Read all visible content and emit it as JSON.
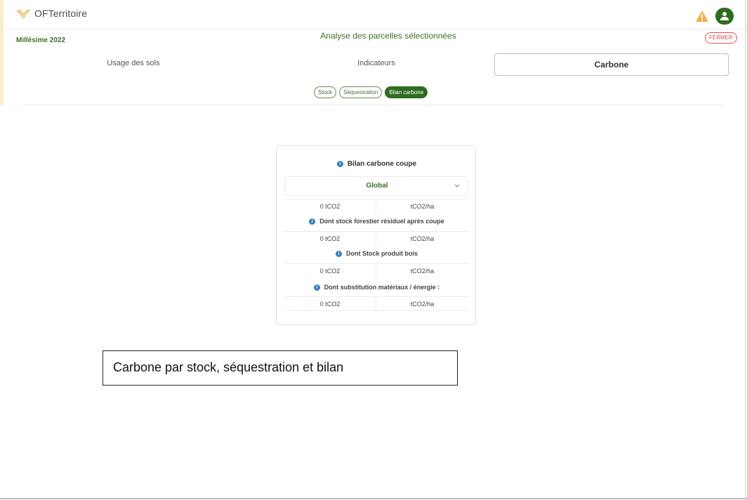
{
  "app": {
    "name": "OFTerritoire",
    "colors": {
      "brand_green": "#2e6b1f",
      "text_green": "#3f6f2a",
      "warning": "#f0ad4e",
      "danger": "#d9534f",
      "info": "#3a7fc1"
    }
  },
  "header": {
    "logo_icon": "bird-logo-icon",
    "warning_icon": "warning-triangle-icon",
    "user_icon": "user-icon"
  },
  "subheader": {
    "millesime": "Millésime 2022",
    "title": "Analyse des parcelles sélectionnées",
    "close_label": "FERMER"
  },
  "tabs": [
    {
      "label": "Usage des sols",
      "active": false
    },
    {
      "label": "Indicateurs",
      "active": false
    },
    {
      "label": "Carbone",
      "active": true
    }
  ],
  "pills": [
    {
      "label": "Stock",
      "active": false
    },
    {
      "label": "Séquestration",
      "active": false
    },
    {
      "label": "Bilan carbone",
      "active": true
    }
  ],
  "card": {
    "title": "Bilan carbone coupe",
    "select": {
      "selected": "Global"
    },
    "rows": [
      {
        "left": "0 tCO2",
        "right": "tCO2/ha"
      },
      {
        "left": "0 tCO2",
        "right": "tCO2/ha"
      },
      {
        "left": "0 tCO2",
        "right": "tCO2/ha"
      },
      {
        "left": "0 tCO2",
        "right": "tCO2/ha"
      }
    ],
    "subtitles": [
      "Dont stock forestier résiduel après coupe",
      "Dont Stock produit bois",
      "Dont substitution matériaux / énergie :"
    ]
  },
  "caption": "Carbone par stock, séquestration et bilan"
}
